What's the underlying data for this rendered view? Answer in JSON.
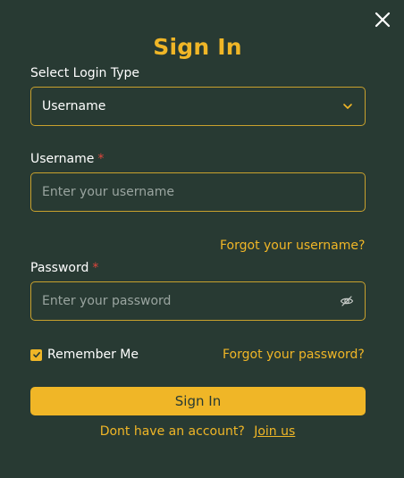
{
  "modal": {
    "title": "Sign In",
    "close_icon": "close-icon"
  },
  "login_type": {
    "label": "Select Login Type",
    "selected": "Username",
    "icon": "chevron-down-icon"
  },
  "username": {
    "label": "Username",
    "required_marker": "*",
    "placeholder": "Enter your username",
    "value": "",
    "forgot_link": "Forgot your username?"
  },
  "password": {
    "label": "Password",
    "required_marker": "*",
    "placeholder": "Enter your password",
    "value": "",
    "toggle_icon": "eye-off-icon",
    "forgot_link": "Forgot your password?"
  },
  "remember": {
    "label": "Remember Me",
    "checked": true
  },
  "actions": {
    "sign_in_label": "Sign In"
  },
  "footer": {
    "prompt": "Dont have an account?",
    "join_link": "Join us"
  },
  "colors": {
    "background": "#283a33",
    "accent": "#f0b627",
    "border": "#c9a12d",
    "required": "#e0463c"
  }
}
